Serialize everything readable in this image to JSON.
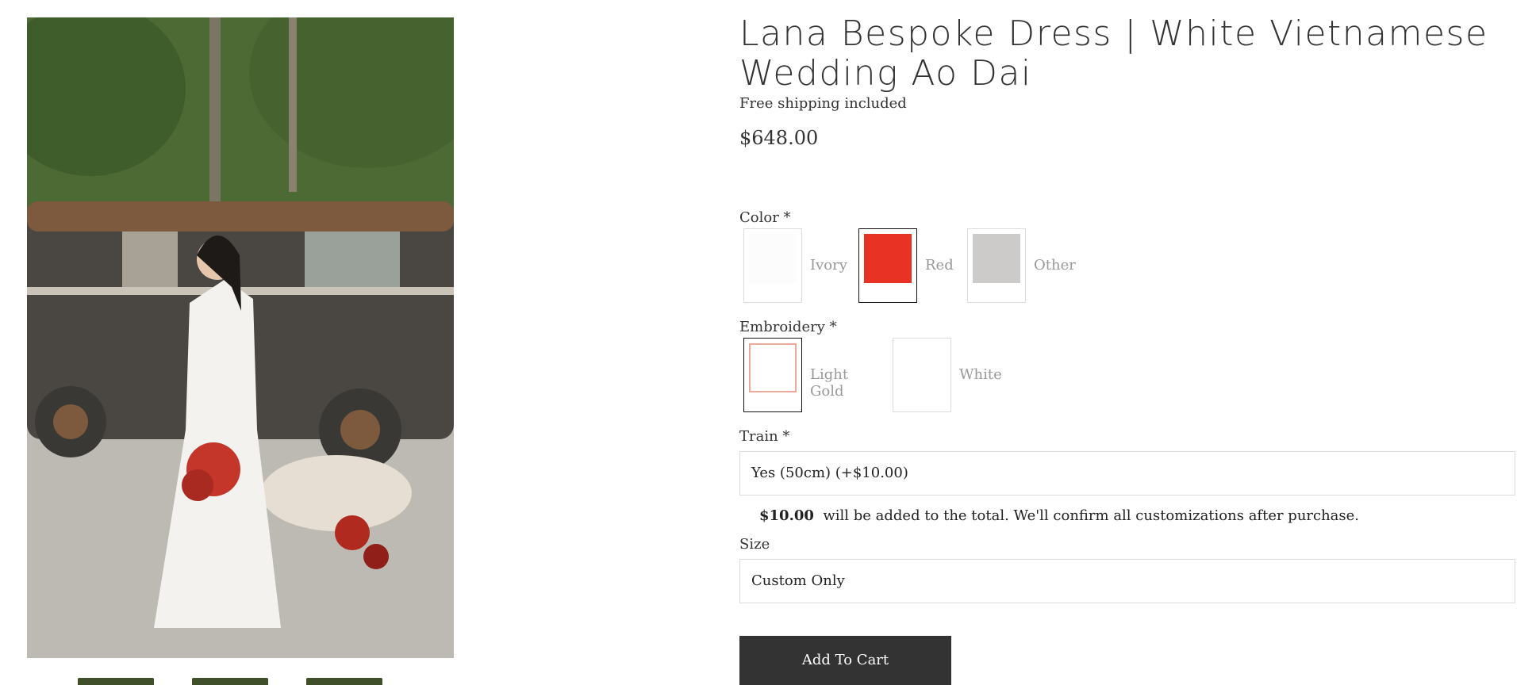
{
  "product": {
    "title": "Lana Bespoke Dress | White Vietnamese Wedding Ao Dai",
    "shipping_note": "Free shipping included",
    "price": "$648.00"
  },
  "gallery": {
    "thumbnail_count": 3
  },
  "options": {
    "color": {
      "label": "Color *",
      "choices": [
        {
          "name": "Ivory",
          "swatch_color": "#fcfcfc",
          "selected": false
        },
        {
          "name": "Red",
          "swatch_color": "#e83324",
          "selected": true
        },
        {
          "name": "Other",
          "swatch_color": "#cccbca",
          "selected": false
        }
      ]
    },
    "embroidery": {
      "label": "Embroidery *",
      "choices": [
        {
          "name": "Light Gold",
          "swatch_color": "#ffffff",
          "swatch_border": "#e8a89a",
          "selected": true
        },
        {
          "name": "White",
          "swatch_color": "#ffffff",
          "selected": false
        }
      ]
    },
    "train": {
      "label": "Train *",
      "value": "Yes (50cm) (+$10.00)",
      "note_amount": "$10.00",
      "note_text": "will be added to the total. We'll confirm all customizations after purchase."
    },
    "size": {
      "label": "Size",
      "value": "Custom Only"
    }
  },
  "add_to_cart_label": "Add To Cart"
}
